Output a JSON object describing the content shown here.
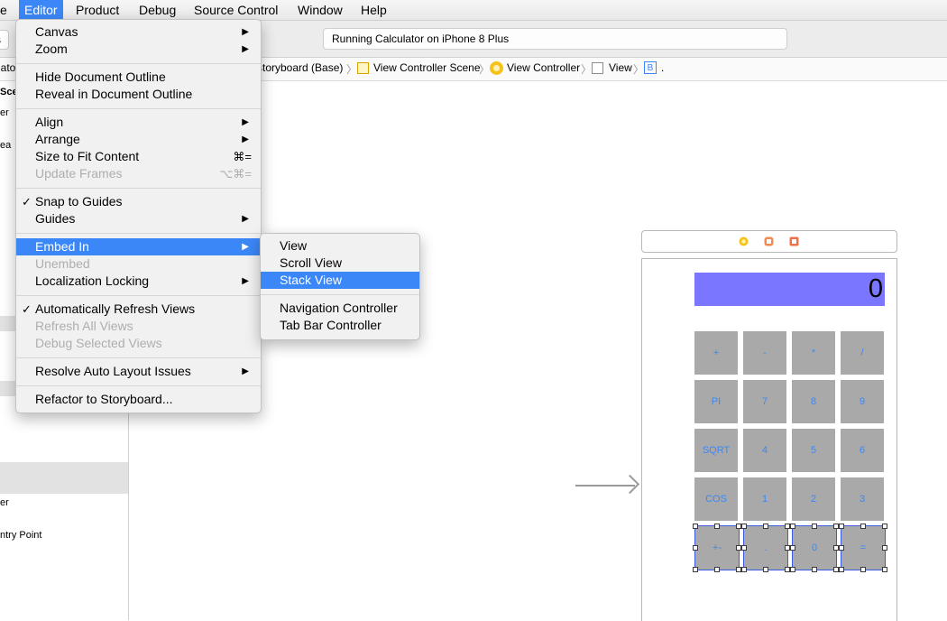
{
  "menubar": {
    "items": [
      {
        "label": "e"
      },
      {
        "label": "Editor"
      },
      {
        "label": "Product"
      },
      {
        "label": "Debug"
      },
      {
        "label": "Source Control"
      },
      {
        "label": "Window"
      },
      {
        "label": "Help"
      }
    ],
    "active_color": "#3b87f7"
  },
  "toolbar": {
    "scheme_fragment": "s",
    "activity_text": "Running Calculator on iPhone 8 Plus"
  },
  "jumpbar": {
    "fragment": "lato",
    "items": [
      "storyboard (Base)",
      "View Controller Scene",
      "View Controller",
      "View",
      "B",
      "."
    ],
    "sep": "〉",
    "b_badge": "B"
  },
  "outline": {
    "fragments": [
      "Sce",
      "er",
      "ea",
      "er",
      "ntry Point"
    ]
  },
  "editor_menu": {
    "items": [
      {
        "label": "Canvas",
        "submenu": true
      },
      {
        "label": "Zoom",
        "submenu": true
      },
      {
        "label": "Hide Document Outline"
      },
      {
        "label": "Reveal in Document Outline"
      },
      {
        "label": "Align",
        "submenu": true
      },
      {
        "label": "Arrange",
        "submenu": true
      },
      {
        "label": "Size to Fit Content",
        "shortcut": "⌘="
      },
      {
        "label": "Update Frames",
        "shortcut": "⌥⌘=",
        "disabled": true
      },
      {
        "label": "Snap to Guides",
        "checked": true
      },
      {
        "label": "Guides",
        "submenu": true
      },
      {
        "label": "Embed In",
        "submenu": true,
        "highlighted": true
      },
      {
        "label": "Unembed",
        "disabled": true
      },
      {
        "label": "Localization Locking",
        "submenu": true
      },
      {
        "label": "Automatically Refresh Views",
        "checked": true
      },
      {
        "label": "Refresh All Views",
        "disabled": true
      },
      {
        "label": "Debug Selected Views",
        "disabled": true
      },
      {
        "label": "Resolve Auto Layout Issues",
        "submenu": true
      },
      {
        "label": "Refactor to Storyboard..."
      }
    ],
    "check_glyph": "✓",
    "arrow_glyph": "▶"
  },
  "embed_submenu": {
    "items": [
      {
        "label": "View"
      },
      {
        "label": "Scroll View"
      },
      {
        "label": "Stack View",
        "highlighted": true
      },
      {
        "label": "Navigation Controller"
      },
      {
        "label": "Tab Bar Controller"
      }
    ]
  },
  "calculator": {
    "display": "0",
    "display_color": "#7a76ff",
    "key_color": "#a9a9a9",
    "key_text_color": "#3b87f7",
    "rows": [
      [
        "+",
        "-",
        "*",
        "/"
      ],
      [
        "PI",
        "7",
        "8",
        "9"
      ],
      [
        "SQRT",
        "4",
        "5",
        "6"
      ],
      [
        "COS",
        "1",
        "2",
        "3"
      ],
      [
        "+-",
        ".",
        "0",
        "="
      ]
    ]
  }
}
